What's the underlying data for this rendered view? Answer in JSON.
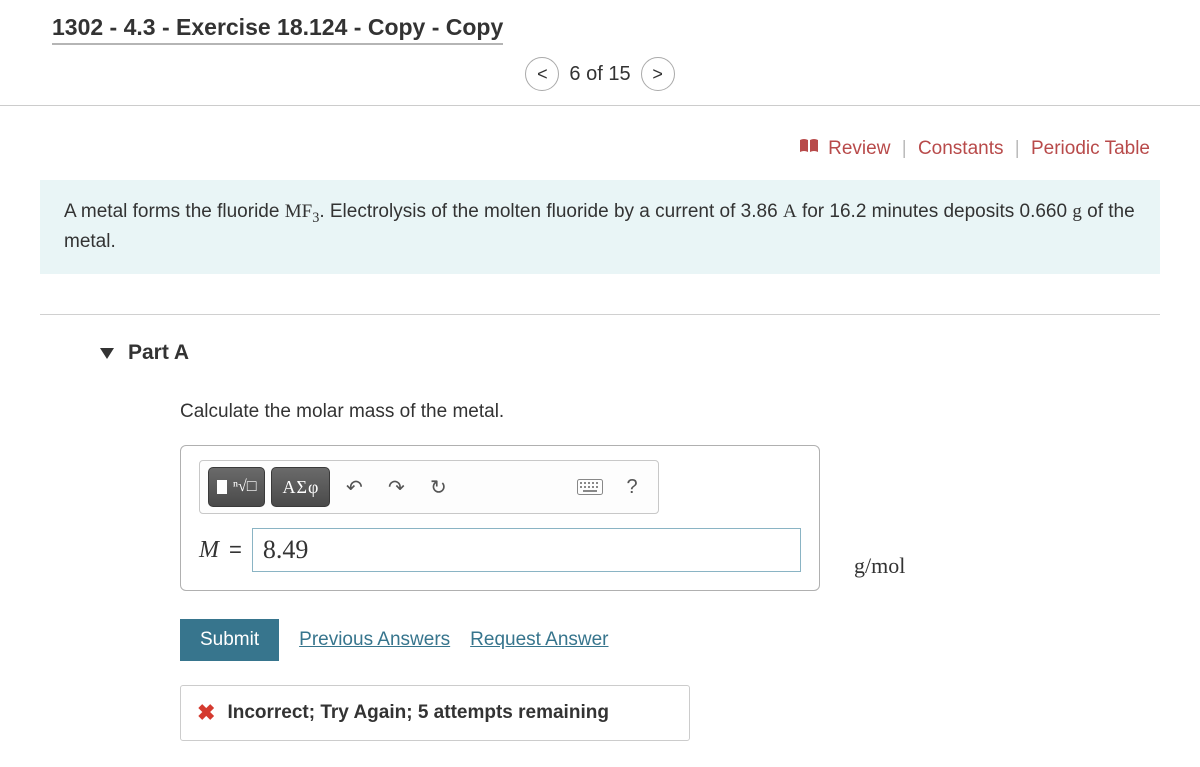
{
  "header": {
    "title": "1302 - 4.3 - Exercise 18.124 - Copy - Copy",
    "pager": {
      "prev": "<",
      "text": "6 of 15",
      "next": ">"
    }
  },
  "top_links": {
    "review": "Review",
    "constants": "Constants",
    "periodic": "Periodic Table"
  },
  "problem": {
    "pre": "A metal forms the fluoride ",
    "formula": "MF",
    "formula_sub": "3",
    "mid": ". Electrolysis of the molten fluoride by a current of 3.86 ",
    "current_unit": "A",
    "mid2": " for 16.2 minutes deposits 0.660 ",
    "mass_unit": "g",
    "post": " of the metal."
  },
  "part": {
    "label": "Part A",
    "instruction": "Calculate the molar mass of the metal.",
    "toolbar": {
      "templates": "templates",
      "greek": "ΑΣφ",
      "undo": "↶",
      "redo": "↷",
      "reset": "↻",
      "keyboard": "⌨",
      "help": "?"
    },
    "variable": "M",
    "equals": "=",
    "answer_value": "8.49",
    "unit": "g/mol",
    "submit": "Submit",
    "previous": "Previous Answers",
    "request": "Request Answer",
    "feedback": "Incorrect; Try Again; 5 attempts remaining"
  }
}
